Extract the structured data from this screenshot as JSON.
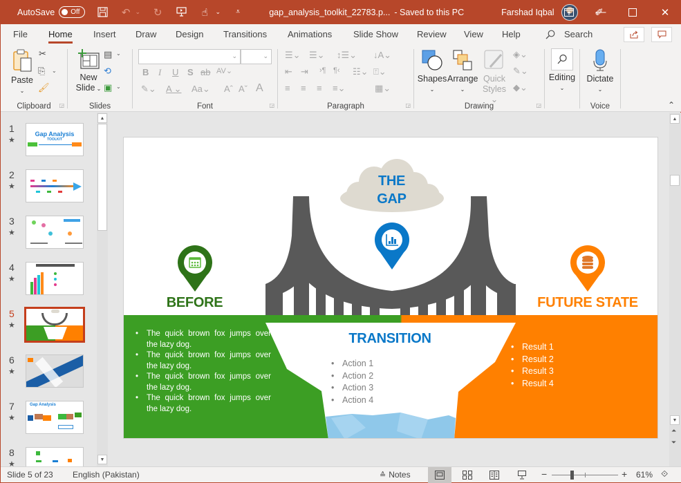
{
  "titlebar": {
    "autosave_label": "AutoSave",
    "autosave_state": "Off",
    "filename": "gap_analysis_toolkit_22783.p...",
    "save_status": "-  Saved to this PC",
    "user_name": "Farshad Iqbal",
    "icons": [
      "save-icon",
      "undo-icon",
      "redo-icon",
      "present-icon",
      "touch-mode-icon",
      "customize-icon"
    ],
    "window_controls": [
      "minimize",
      "maximize",
      "close"
    ]
  },
  "tabs": {
    "items": [
      "File",
      "Home",
      "Insert",
      "Draw",
      "Design",
      "Transitions",
      "Animations",
      "Slide Show",
      "Review",
      "View",
      "Help"
    ],
    "active": "Home",
    "search_label": "Search"
  },
  "ribbon": {
    "groups": {
      "clipboard": {
        "label": "Clipboard",
        "paste": "Paste"
      },
      "slides": {
        "label": "Slides",
        "new_slide_1": "New",
        "new_slide_2": "Slide"
      },
      "font": {
        "label": "Font",
        "font_name": "",
        "font_size": ""
      },
      "paragraph": {
        "label": "Paragraph"
      },
      "drawing": {
        "label": "Drawing",
        "shapes": "Shapes",
        "arrange": "Arrange",
        "quick_styles_1": "Quick",
        "quick_styles_2": "Styles"
      },
      "editing": {
        "label": "",
        "editing": "Editing"
      },
      "voice": {
        "label": "Voice",
        "dictate": "Dictate"
      }
    }
  },
  "thumbnails": {
    "items": [
      {
        "num": "1",
        "title": "Gap Analysis",
        "subtitle": "TOOLKIT"
      },
      {
        "num": "2"
      },
      {
        "num": "3"
      },
      {
        "num": "4"
      },
      {
        "num": "5",
        "active": true
      },
      {
        "num": "6"
      },
      {
        "num": "7",
        "title": "Gap Analysis"
      },
      {
        "num": "8"
      }
    ],
    "star": "★"
  },
  "slide": {
    "cloud_title_1": "THE",
    "cloud_title_2": "GAP",
    "before_heading": "BEFORE",
    "future_heading": "FUTURE STATE",
    "transition_heading": "TRANSITION",
    "before_bullets": [
      "The quick brown fox jumps over the lazy dog.",
      "The quick brown fox jumps over the lazy dog.",
      "The quick brown fox jumps over the lazy dog.",
      "The quick brown fox jumps over the lazy dog."
    ],
    "transition_bullets": [
      "Action 1",
      "Action 2",
      "Action 3",
      "Action 4"
    ],
    "future_bullets": [
      "Result 1",
      "Result 2",
      "Result 3",
      "Result 4"
    ],
    "colors": {
      "green": "#3c9e24",
      "dark_green": "#2e7318",
      "orange": "#ff8000",
      "blue": "#0a78c8",
      "bridge_gray": "#595959",
      "cloud": "#dedad0",
      "water": "#8fc8ea"
    }
  },
  "statusbar": {
    "slide_indicator": "Slide 5 of 23",
    "language": "English (Pakistan)",
    "notes_label": "Notes",
    "zoom_level": "61%",
    "zoom_fraction": 0.3
  }
}
